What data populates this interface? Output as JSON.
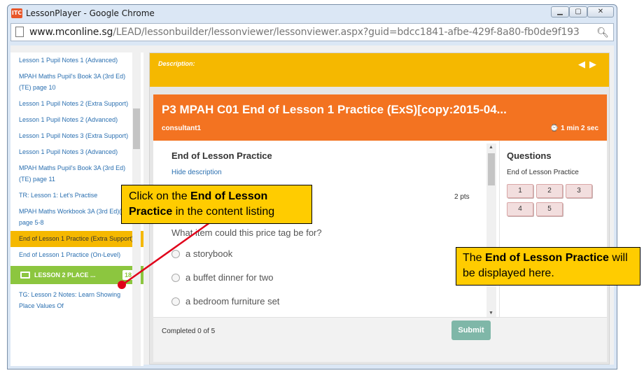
{
  "window": {
    "title": "LessonPlayer - Google Chrome",
    "app_icon_label": "ITC",
    "url_domain": "www.mconline.sg",
    "url_path": "/LEAD/lessonbuilder/lessonviewer/lessonviewer.aspx?guid=bdcc1841-afbe-429f-8a80-fb0de9f193",
    "minimize": "▁",
    "restore": "▢",
    "close": "✕"
  },
  "sidebar": {
    "items": [
      "Lesson 1 Pupil Notes 1 (Advanced)",
      "MPAH Maths Pupil's Book 3A (3rd Ed)(TE) page 10",
      "Lesson 1 Pupil Notes 2 (Extra Support)",
      "Lesson 1 Pupil Notes 2 (Advanced)",
      "Lesson 1 Pupil Notes 3 (Extra Support)",
      "Lesson 1 Pupil Notes 3 (Advanced)",
      "MPAH Maths Pupil's Book 3A (3rd Ed)(TE) page 11",
      "TR: Lesson 1: Let's Practise",
      "MPAH Maths Workbook 3A (3rd Ed)(TE) page 5-8"
    ],
    "active_item": "End of Lesson 1 Practice (Extra Support)",
    "next_item": "End of Lesson 1 Practice (On-Level)",
    "lesson_bar_label": "LESSON 2 PLACE ...",
    "lesson_bar_count": "18",
    "after_item": "TG: Lesson 2 Notes: Learn Showing Place Values Of"
  },
  "main": {
    "description_label": "Description:",
    "nav_prev": "◀",
    "nav_next": "▶",
    "card_title": "P3 MPAH C01 End of Lesson 1 Practice (ExS)[copy:2015-04...",
    "author": "consultant1",
    "timer": "1 min 2 sec",
    "timer_icon": "⌚"
  },
  "question": {
    "heading": "End of Lesson Practice",
    "hide_description": "Hide description",
    "points": "2 pts",
    "text": "What item could this price tag be for?",
    "options": [
      "a storybook",
      "a buffet dinner for two",
      "a bedroom furniture set"
    ]
  },
  "questions_panel": {
    "title": "Questions",
    "subtitle": "End of Lesson Practice",
    "buttons": [
      "1",
      "2",
      "3",
      "4",
      "5"
    ]
  },
  "footer": {
    "completed": "Completed 0 of 5",
    "submit": "Submit"
  },
  "callouts": {
    "left_pre": "Click on the ",
    "left_bold": "End of Lesson Practice",
    "left_post": " in the content listing",
    "right_pre": "The ",
    "right_bold": "End of Lesson Practice",
    "right_post": " will be displayed here."
  },
  "colors": {
    "accent_orange": "#f37321",
    "accent_yellow": "#f5b800",
    "lesson_green": "#8cc63f",
    "callout_yellow": "#ffcc00",
    "pointer_red": "#e0001a"
  }
}
